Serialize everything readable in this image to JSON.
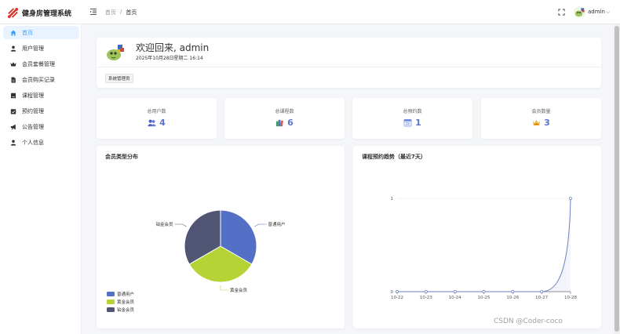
{
  "header": {
    "app_title": "健身房管理系统",
    "breadcrumb": [
      "首页",
      "/",
      "首页"
    ],
    "user_name": "admin",
    "caret": "⌵"
  },
  "sidebar": {
    "items": [
      {
        "label": "首页",
        "icon": "home-icon",
        "active": true
      },
      {
        "label": "用户管理",
        "icon": "user-icon",
        "active": false
      },
      {
        "label": "会员套餐管理",
        "icon": "crown-icon",
        "active": false
      },
      {
        "label": "会员购买记录",
        "icon": "document-icon",
        "active": false
      },
      {
        "label": "课程管理",
        "icon": "book-icon",
        "active": false
      },
      {
        "label": "预约管理",
        "icon": "calendar-check-icon",
        "active": false
      },
      {
        "label": "公告管理",
        "icon": "megaphone-icon",
        "active": false
      },
      {
        "label": "个人信息",
        "icon": "person-icon",
        "active": false
      }
    ]
  },
  "welcome": {
    "title": "欢迎回来, admin",
    "datetime": "2025年10月28日星期二 16:14",
    "role_tag": "系统管理员"
  },
  "stats": [
    {
      "label": "总用户数",
      "value": "4",
      "icon": "users-emoji-icon"
    },
    {
      "label": "总课程数",
      "value": "6",
      "icon": "books-emoji-icon"
    },
    {
      "label": "总预约数",
      "value": "1",
      "icon": "calendar-emoji-icon"
    },
    {
      "label": "会员数量",
      "value": "3",
      "icon": "crown-emoji-icon"
    }
  ],
  "pie_panel": {
    "title": "会员类型分布"
  },
  "trend_panel": {
    "title": "课程预约趋势（最近7天）"
  },
  "chart_data": [
    {
      "type": "pie",
      "labels": [
        "普通用户",
        "黄金会员",
        "铂金会员"
      ],
      "values": [
        1,
        1,
        1
      ],
      "colors": [
        "#5470c6",
        "#b5d334",
        "#4f5573"
      ],
      "legend": "bottom-left"
    },
    {
      "type": "line",
      "x": [
        "10-22",
        "10-23",
        "10-24",
        "10-25",
        "10-26",
        "10-27",
        "10-28"
      ],
      "series": [
        {
          "values": [
            0,
            0,
            0,
            0,
            0,
            0,
            1
          ]
        }
      ],
      "ylim": [
        0,
        1
      ],
      "yticks": [
        "0",
        "1"
      ],
      "smooth": true,
      "color": "#6b7fc4"
    }
  ],
  "watermark": "CSDN @Coder-coco",
  "colors": {
    "accent": "#409eff",
    "active_bg": "#e8f3ff",
    "stat_value": "#5b74c9"
  }
}
